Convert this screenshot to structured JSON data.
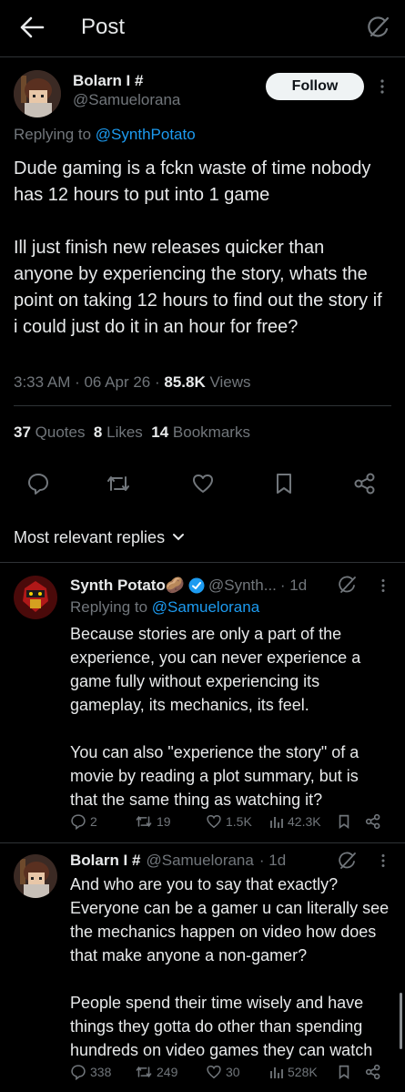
{
  "header": {
    "title": "Post",
    "back_icon": "arrow-left-icon",
    "grok_icon": "slash-circle-icon"
  },
  "post": {
    "author_name": "Bolarn I #",
    "handle": "@Samuelorana",
    "follow_label": "Follow",
    "replying_prefix": "Replying to",
    "replying_to": "@SynthPotato",
    "text": "Dude gaming is a fckn waste of time nobody has 12 hours to put into 1 game\n\nIll just finish new releases quicker than anyone by experiencing the story, whats the point on taking 12 hours to find out the story if i could just do it in an hour for free?",
    "time": "3:33 AM · 06 Apr 26 · ",
    "views": "85.8K",
    "views_label": "Views",
    "quotes_count": "37",
    "quotes_label": "Quotes",
    "likes_count": "8",
    "likes_label": "Likes",
    "bookmarks_count": "14",
    "bookmarks_label": "Bookmarks"
  },
  "sort": {
    "label": "Most relevant replies"
  },
  "replies": [
    {
      "author_name": "Synth Potato🥔",
      "handle": "@Synth...",
      "time": "· 1d",
      "replying_prefix": "Replying to",
      "replying_to": "@Samuelorana",
      "text": "Because stories are only a part of the experience, you can never experience a game fully without experiencing its gameplay, its mechanics, its feel.\n\nYou can also \"experience the story\" of a movie by reading a plot summary, but is that the same thing as watching it?",
      "replies": "2",
      "reposts": "19",
      "likes": "1.5K",
      "views": "42.3K"
    },
    {
      "author_name": "Bolarn I #",
      "handle": "@Samuelorana",
      "time": "· 1d",
      "text": "And who are you to say that exactly? Everyone can be a gamer u can literally see the mechanics happen on video how does that make anyone a non-gamer?\n\nPeople spend their time wisely and have things they gotta do other than spending hundreds on video games they can watch",
      "replies": "338",
      "reposts": "249",
      "likes": "30",
      "views": "528K"
    }
  ],
  "colors": {
    "background": "#000000",
    "text": "#e7e9ea",
    "muted": "#71767b",
    "link": "#1d9bf0",
    "verified": "#1d9bf0",
    "divider": "#2f3336"
  }
}
